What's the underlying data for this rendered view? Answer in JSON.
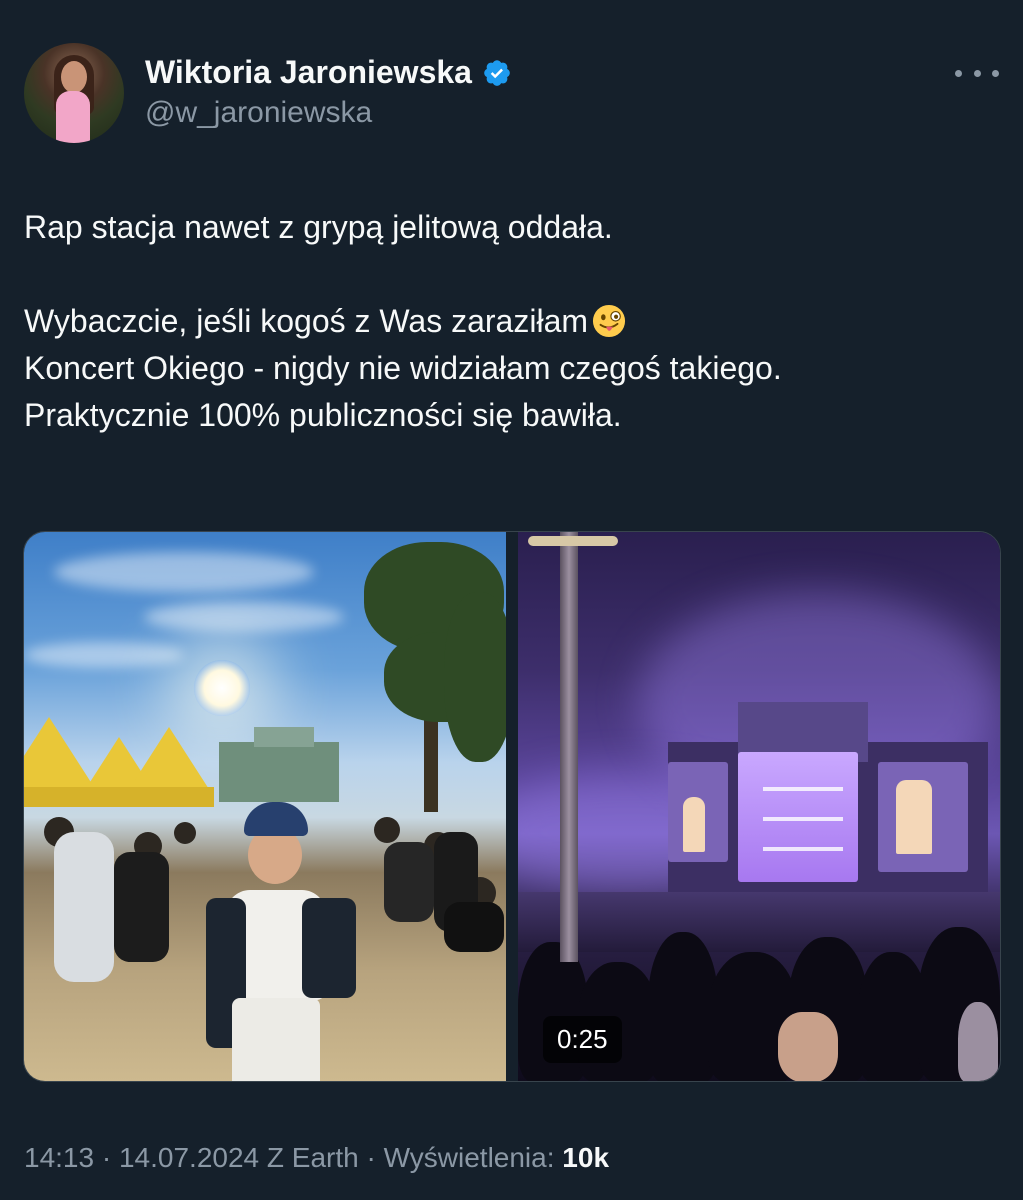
{
  "author": {
    "name": "Wiktoria Jaroniewska",
    "handle": "@w_jaroniewska",
    "verified": true
  },
  "more_icon": "more-horizontal-icon",
  "tweet": {
    "line1": "Rap stacja nawet z grypą jelitową oddała.",
    "line2": "Wybaczcie, jeśli kogoś z Was zaraziłam",
    "line2_emoji": "winking-face-with-tongue",
    "line3": "Koncert Okiego - nigdy nie widziałam czegoś takiego.",
    "line4": "Praktycznie 100% publiczności się bawiła."
  },
  "media": {
    "video_duration": "0:25"
  },
  "meta": {
    "time": "14:13",
    "date": "14.07.2024",
    "source": "Z Earth",
    "views_label": "Wyświetlenia:",
    "views_count": "10k",
    "separator": " · "
  },
  "colors": {
    "background": "#15202b",
    "text": "#f7f9f9",
    "secondary": "#8b98a5",
    "verified": "#1d9bf0"
  }
}
